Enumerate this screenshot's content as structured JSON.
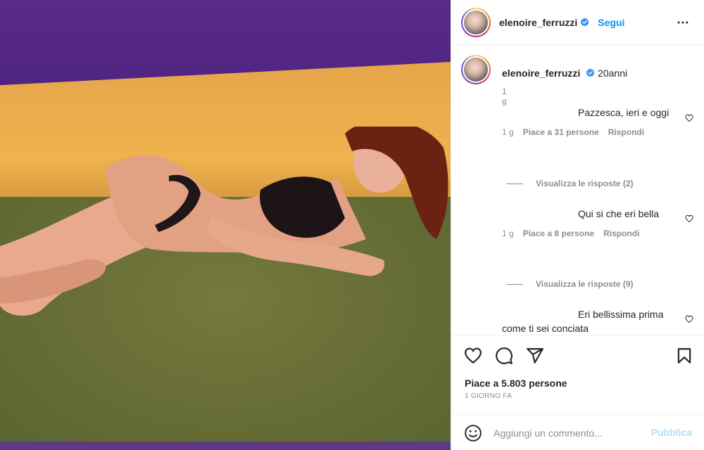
{
  "post": {
    "username": "elenoire_ferruzzi",
    "follow_label": "Segui",
    "more_icon": "more-horizontal-icon",
    "verified_icon": "verified-badge-icon",
    "verified_color": "#3897f0"
  },
  "caption": {
    "username": "elenoire_ferruzzi",
    "text": "20anni",
    "time": "1 g"
  },
  "comments": [
    {
      "text": "Pazzesca, ieri e oggi",
      "time": "1 g",
      "likes": "Piace a 31 persone",
      "reply": "Rispondi",
      "view_replies": "Visualizza le risposte (2)"
    },
    {
      "text": "Qui si che eri bella",
      "time": "1 g",
      "likes": "Piace a 8 persone",
      "reply": "Rispondi",
      "view_replies": "Visualizza le risposte (9)"
    },
    {
      "text": "Eri bellissima prima come ti sei conciata"
    }
  ],
  "actions": {
    "like_icon": "heart-icon",
    "comment_icon": "comment-icon",
    "share_icon": "send-icon",
    "save_icon": "bookmark-icon",
    "likes_count": "Piace a 5.803 persone",
    "date": "1 GIORNO FA"
  },
  "add_comment": {
    "emoji_icon": "emoji-icon",
    "placeholder": "Aggiungi un commento...",
    "publish_label": "Pubblica"
  },
  "colors": {
    "accent": "#0095f6",
    "muted": "#8e8e8e",
    "publish_disabled": "#b2dffc"
  }
}
